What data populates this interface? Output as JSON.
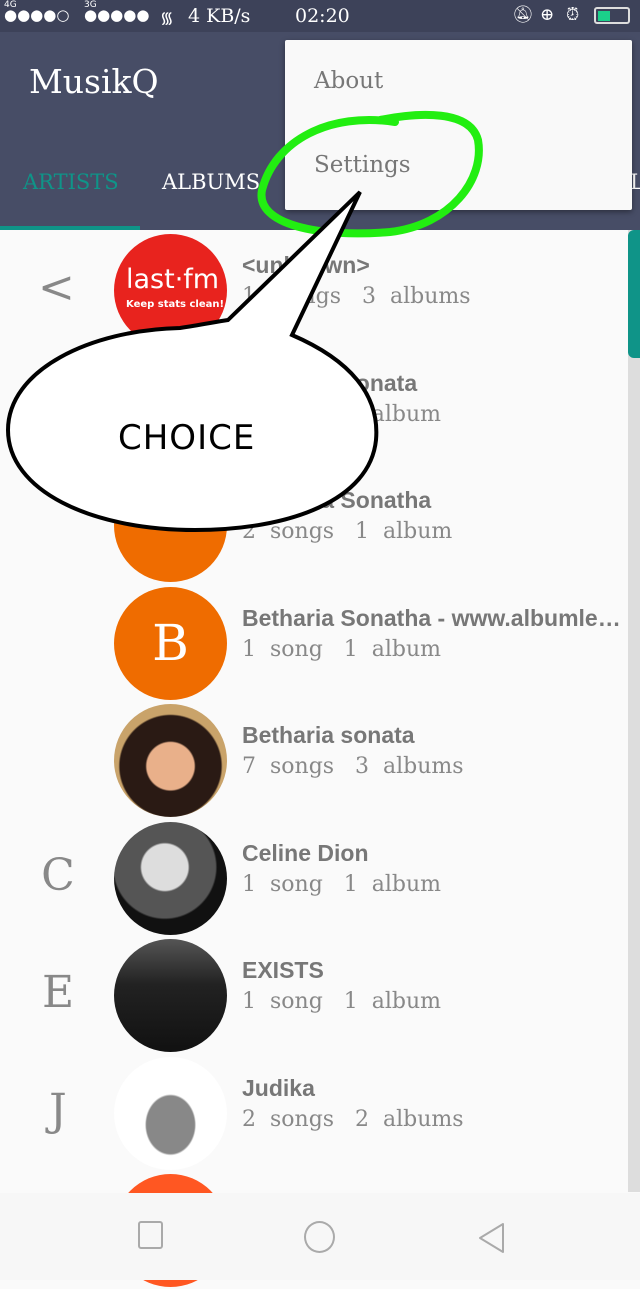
{
  "status": {
    "network1": "4G",
    "signal1": "●●●●○",
    "network2": "3G",
    "signal2": "●●●●●",
    "speed": "4 KB/s",
    "time": "02:20",
    "icons": [
      "mute-bell-icon",
      "rotation-lock-icon",
      "alarm-icon",
      "battery-charging-icon"
    ]
  },
  "app": {
    "title": "MusikQ"
  },
  "tabs": [
    {
      "label": "ARTISTS"
    },
    {
      "label": "ALBUMS"
    },
    {
      "label": "L"
    }
  ],
  "menu": {
    "items": [
      {
        "label": "About"
      },
      {
        "label": "Settings"
      }
    ]
  },
  "annotation": {
    "text": "CHOICE"
  },
  "index_back": "<",
  "artists": [
    {
      "letter": "",
      "name": "<unknown>",
      "meta": "1   songs   3  albums",
      "avatar": "lastfm",
      "avatar_text": "last·fm",
      "avatar_sub": "Keep stats clean!"
    },
    {
      "letter": "",
      "name": "Betharia Sonata",
      "meta": "1  song   1  album",
      "avatar": "orange",
      "avatar_text": ""
    },
    {
      "letter": "",
      "name": "Betharia Sonatha",
      "meta": "2  songs   1  album",
      "avatar": "orange",
      "avatar_text": ""
    },
    {
      "letter": "",
      "name": "Betharia Sonatha - www.albumlengkap",
      "meta": "1  song   1  album",
      "avatar": "orange",
      "avatar_text": "B"
    },
    {
      "letter": "",
      "name": "Betharia sonata",
      "meta": "7  songs   3  albums",
      "avatar": "photo1",
      "avatar_text": ""
    },
    {
      "letter": "C",
      "name": "Celine Dion",
      "meta": "1  song   1  album",
      "avatar": "photo2",
      "avatar_text": ""
    },
    {
      "letter": "E",
      "name": "EXISTS",
      "meta": "1  song   1  album",
      "avatar": "photo3",
      "avatar_text": ""
    },
    {
      "letter": "J",
      "name": "Judika",
      "meta": "2  songs   2  albums",
      "avatar": "photo4",
      "avatar_text": ""
    },
    {
      "letter": "",
      "name": "",
      "meta": "",
      "avatar": "red",
      "avatar_text": ""
    }
  ],
  "colors": {
    "accent": "#0f9488",
    "toolbar": "#474d66",
    "orange": "#ef6c00",
    "highlight": "#22ee11"
  }
}
